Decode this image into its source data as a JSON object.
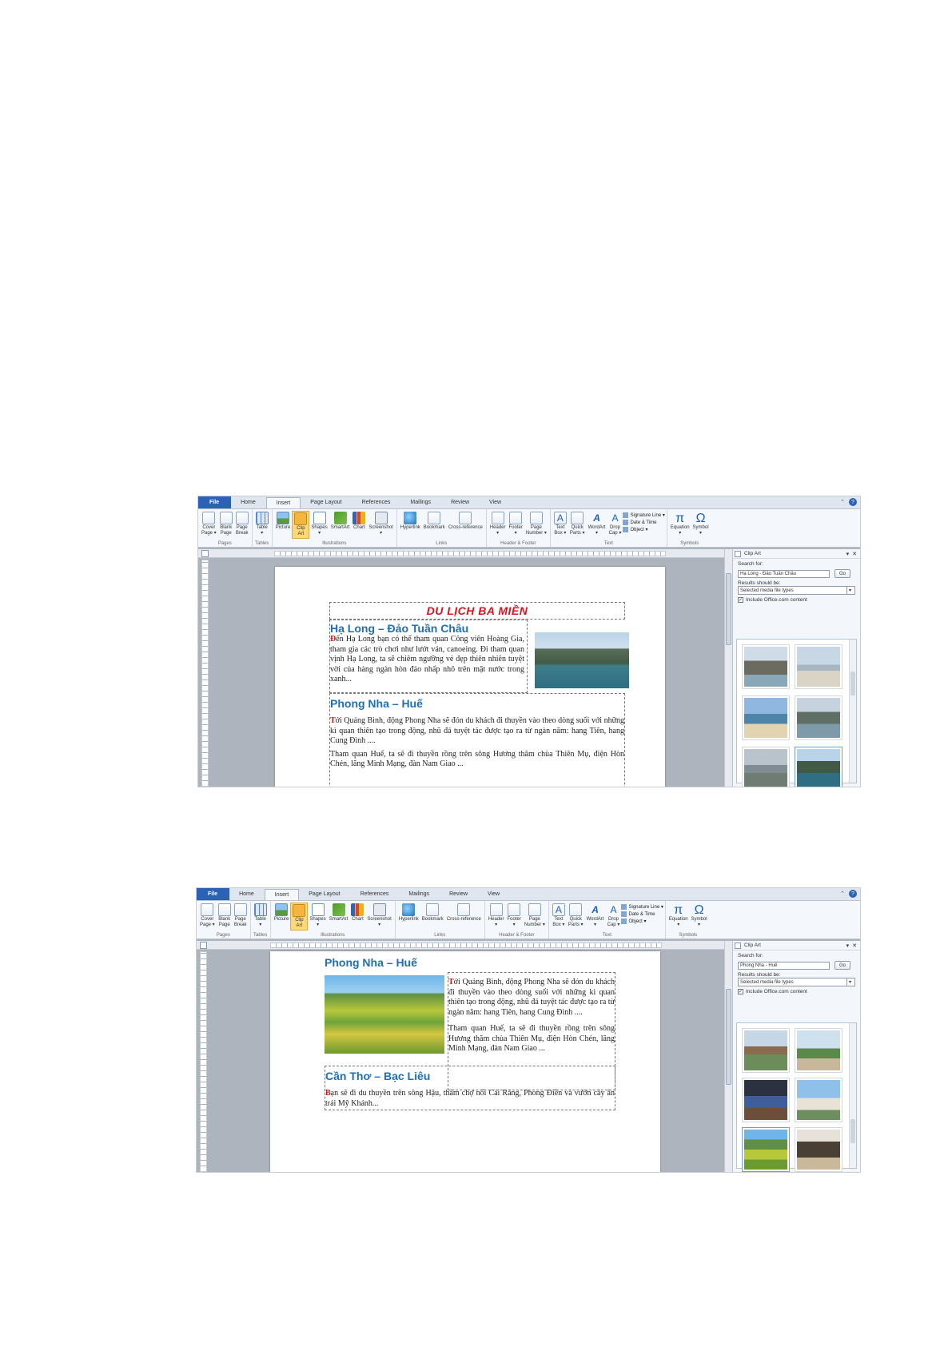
{
  "ribbon": {
    "tabs": [
      "File",
      "Home",
      "Insert",
      "Page Layout",
      "References",
      "Mailings",
      "Review",
      "View"
    ],
    "active_tab": "Insert",
    "groups": {
      "pages": {
        "label": "Pages",
        "buttons": [
          {
            "l1": "Cover",
            "l2": "Page ▾"
          },
          {
            "l1": "Blank",
            "l2": "Page"
          },
          {
            "l1": "Page",
            "l2": "Break"
          }
        ]
      },
      "tables": {
        "label": "Tables",
        "buttons": [
          {
            "l1": "Table",
            "l2": "▾"
          }
        ]
      },
      "illustrations": {
        "label": "Illustrations",
        "buttons": [
          {
            "l1": "Picture",
            "l2": ""
          },
          {
            "l1": "Clip",
            "l2": "Art"
          },
          {
            "l1": "Shapes",
            "l2": "▾"
          },
          {
            "l1": "SmartArt",
            "l2": ""
          },
          {
            "l1": "Chart",
            "l2": ""
          },
          {
            "l1": "Screenshot",
            "l2": "▾"
          }
        ]
      },
      "links": {
        "label": "Links",
        "buttons": [
          {
            "l1": "Hyperlink",
            "l2": ""
          },
          {
            "l1": "Bookmark",
            "l2": ""
          },
          {
            "l1": "Cross-reference",
            "l2": ""
          }
        ]
      },
      "header_footer": {
        "label": "Header & Footer",
        "buttons": [
          {
            "l1": "Header",
            "l2": "▾"
          },
          {
            "l1": "Footer",
            "l2": "▾"
          },
          {
            "l1": "Page",
            "l2": "Number ▾"
          }
        ]
      },
      "text": {
        "label": "Text",
        "buttons": [
          {
            "l1": "Text",
            "l2": "Box ▾"
          },
          {
            "l1": "Quick",
            "l2": "Parts ▾"
          },
          {
            "l1": "WordArt",
            "l2": "▾"
          },
          {
            "l1": "Drop",
            "l2": "Cap ▾"
          }
        ],
        "small": [
          "Signature Line ▾",
          "Date & Time",
          "Object ▾"
        ]
      },
      "symbols": {
        "label": "Symbols",
        "buttons": [
          {
            "l1": "Equation",
            "l2": "▾"
          },
          {
            "l1": "Symbol",
            "l2": "▾"
          }
        ]
      }
    }
  },
  "pane": {
    "title": "Clip Art",
    "search_label": "Search for:",
    "results_label": "Results should be:",
    "go": "Go",
    "results_value": "Selected media file types",
    "include_label": "Include Office.com content"
  },
  "shot1": {
    "search_value": "Hạ Long - Đảo Tuần Châu",
    "banner": "DU LỊCH BA MIỀN",
    "h1": "Hạ Long – Đảo Tuần Châu",
    "p1_drop": "Đ",
    "p1": "ến Hạ Long bạn có thể tham quan Công viên Hoàng Gia, tham gia các trò chơi như lướt ván, canoeing. Đi tham quan vịnh Hạ Long, ta sẽ chiêm ngưỡng vẻ đẹp thiên nhiên tuyệt vời của hàng ngàn hòn đảo nhấp nhô trên mặt nước trong xanh...",
    "h2": "Phong Nha – Huế",
    "p2_drop": "T",
    "p2": "ới Quảng Bình, động Phong Nha sẽ đón du khách đi thuyền vào theo dòng suối với những kì quan thiên tạo trong động, nhũ đá tuyệt tác được tạo ra từ ngàn năm: hang Tiên, hang Cung Đình ....",
    "p3": "Tham quan Huế, ta sẽ đi thuyền rồng trên sông Hương thăm chùa Thiên Mụ, điện Hòn Chén, lăng Minh Mạng, đàn Nam Giao ..."
  },
  "shot2": {
    "search_value": "Phong Nha - Huế",
    "h1": "Phong Nha – Huế",
    "p1_drop": "T",
    "p1": "ới Quảng Bình, động Phong Nha sẽ đón du khách đi thuyền vào theo dòng suối với những kì quan thiên tạo trong động, nhũ đá tuyệt tác được tạo ra từ ngàn năm: hang Tiên, hang Cung Đình ....",
    "p2": "Tham quan Huế, ta sẽ đi thuyền rồng trên sông Hương thăm chùa Thiên Mụ, điện Hòn Chén, lăng Minh Mạng, đàn Nam Giao ...",
    "h2": "Cần Thơ – Bạc Liêu",
    "p3_drop": "B",
    "p3": "ạn sẽ đi du thuyền trên sông Hậu, thăm chợ nổi Cái Răng, Phong Điền và vườn cây ăn trái Mỹ Khánh..."
  },
  "colors": {
    "accent": "#2b62b5",
    "heading": "#1c6fb8",
    "banner": "#e0101b",
    "active_button": "#fbd97a"
  }
}
